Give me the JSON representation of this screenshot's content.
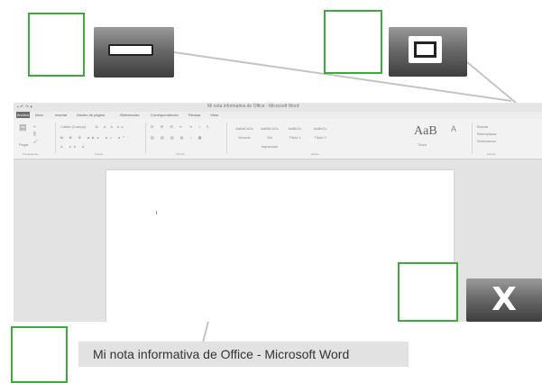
{
  "caption": {
    "text": "Mi nota informativa de Office - Microsoft Word"
  },
  "window": {
    "title": "Mi nota informativa de Office - Microsoft Word",
    "tab_file": "Archivo",
    "tabs": [
      "Inicio",
      "Insertar",
      "Diseño de página",
      "Referencias",
      "Correspondencia",
      "Revisar",
      "Vista"
    ]
  },
  "ribbon": {
    "paste": "Pegar",
    "font_name": "Calibri (Cuerpo)",
    "font_size": "11",
    "styles": [
      "AaBbCcDc",
      "AaBbCcDc",
      "AaBbCc",
      "AaBbCc"
    ],
    "style_names": [
      "Normal",
      "Sin espaciado",
      "Título 1",
      "Título 2"
    ],
    "big_style": "AaB",
    "big_style_name": "Título",
    "find": "Buscar",
    "replace": "Reemplazar",
    "select": "Seleccionar",
    "groups": [
      "Portapapeles",
      "Fuente",
      "Párrafo",
      "Estilos",
      "Edición"
    ]
  },
  "zoom_buttons": {
    "minimize_icon": "minimize-icon",
    "maximize_icon": "maximize-icon",
    "close_icon": "close-icon",
    "close_glyph": "X"
  },
  "colors": {
    "highlight_box": "#3cab3c",
    "button_dark": "#3e3e3e"
  }
}
